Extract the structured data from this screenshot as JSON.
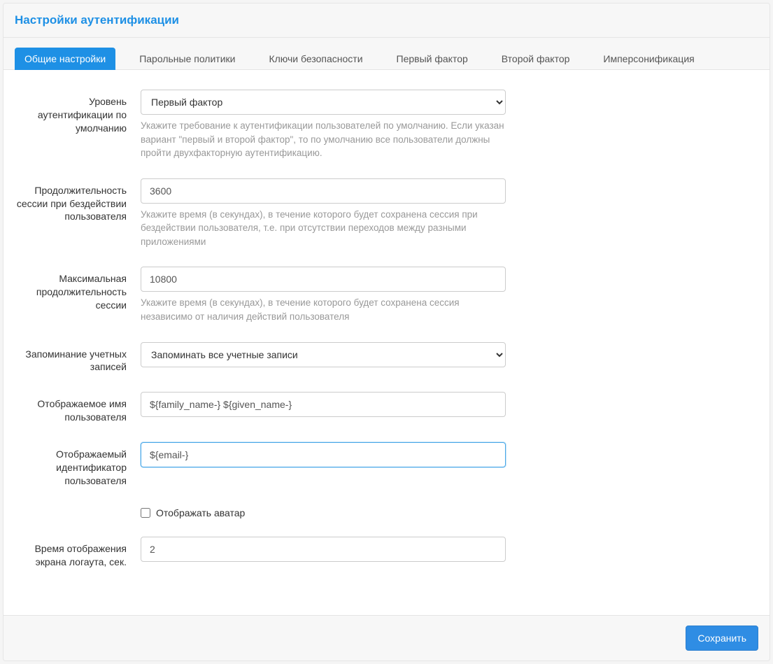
{
  "panel": {
    "title": "Настройки аутентификации"
  },
  "tabs": [
    {
      "label": "Общие настройки",
      "active": true
    },
    {
      "label": "Парольные политики",
      "active": false
    },
    {
      "label": "Ключи безопасности",
      "active": false
    },
    {
      "label": "Первый фактор",
      "active": false
    },
    {
      "label": "Второй фактор",
      "active": false
    },
    {
      "label": "Имперсонификация",
      "active": false
    }
  ],
  "form": {
    "auth_level": {
      "label": "Уровень аутентификации по умолчанию",
      "value": "Первый фактор",
      "help": "Укажите требование к аутентификации пользователей по умолчанию. Если указан вариант \"первый и второй фактор\", то по умолчанию все пользователи должны пройти двухфакторную аутентификацию."
    },
    "idle_session": {
      "label": "Продолжительность сессии при бездействии пользователя",
      "value": "3600",
      "help": "Укажите время (в секундах), в течение которого будет сохранена сессия при бездействии пользователя, т.е. при отсутствии переходов между разными приложениями"
    },
    "max_session": {
      "label": "Максимальная продолжительность сессии",
      "value": "10800",
      "help": "Укажите время (в секундах), в течение которого будет сохранена сессия независимо от наличия действий пользователя"
    },
    "remember_accounts": {
      "label": "Запоминание учетных записей",
      "value": "Запоминать все учетные записи"
    },
    "display_name": {
      "label": "Отображаемое имя пользователя",
      "value": "${family_name-} ${given_name-}"
    },
    "display_id": {
      "label": "Отображаемый идентификатор пользователя",
      "value": "${email-}"
    },
    "show_avatar": {
      "label": "Отображать аватар",
      "checked": false
    },
    "logout_screen_time": {
      "label": "Время отображения экрана логаута, сек.",
      "value": "2"
    }
  },
  "footer": {
    "save_label": "Сохранить"
  }
}
